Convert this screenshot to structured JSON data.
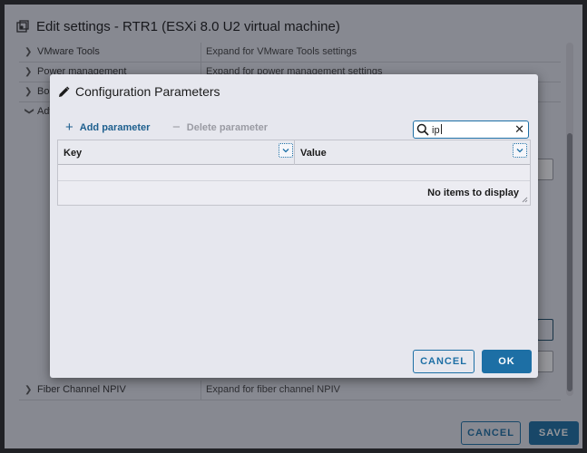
{
  "window": {
    "title": "Edit settings - RTR1 (ESXi 8.0 U2 virtual machine)",
    "cancel_label": "CANCEL",
    "save_label": "SAVE",
    "icon": "vm-settings-icon"
  },
  "settings_rows": [
    {
      "label": "VMware Tools",
      "value": "Expand for VMware Tools settings",
      "expanded": false
    },
    {
      "label": "Power management",
      "value": "Expand for power management settings",
      "expanded": false
    },
    {
      "label": "Boo",
      "value": "",
      "expanded": false
    },
    {
      "label": "Adv",
      "value": "",
      "expanded": true
    },
    {
      "label": "Fiber Channel NPIV",
      "value": "Expand for fiber channel NPIV",
      "expanded": false
    }
  ],
  "dialog": {
    "title": "Configuration Parameters",
    "title_icon": "pencil-icon",
    "add_label": "Add parameter",
    "delete_label": "Delete parameter",
    "search_value": "ip",
    "grid": {
      "columns": [
        "Key",
        "Value"
      ],
      "empty_text": "No items to display"
    },
    "cancel_label": "CANCEL",
    "ok_label": "OK"
  },
  "colors": {
    "accent": "#1d6fa5",
    "dialog_bg": "#e6e7ee",
    "disabled": "#9a9ba3"
  }
}
